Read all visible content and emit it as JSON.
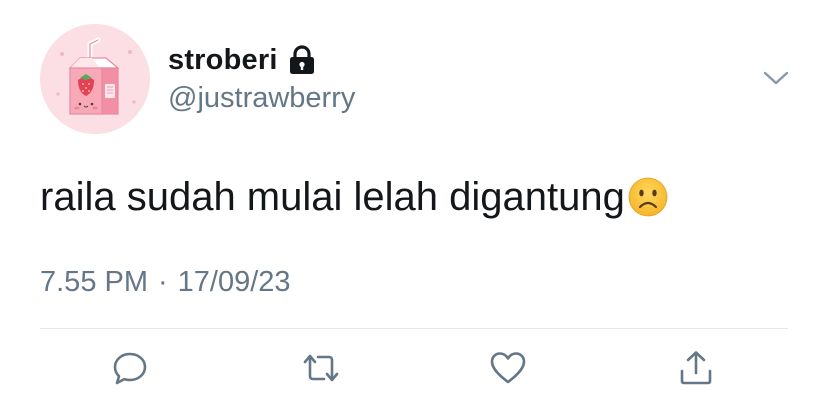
{
  "tweet": {
    "display_name": "stroberi",
    "handle": "@justrawberry",
    "protected_icon": "lock-icon",
    "text": "raila sudah mulai lelah digantung",
    "emoji": "frowning-face",
    "time": "7.55 PM",
    "separator": "·",
    "date": "17/09/23"
  },
  "actions": [
    {
      "name": "reply",
      "icon": "speech-bubble-icon"
    },
    {
      "name": "retweet",
      "icon": "retweet-icon"
    },
    {
      "name": "like",
      "icon": "heart-icon"
    },
    {
      "name": "share",
      "icon": "share-icon"
    }
  ],
  "colors": {
    "text": "#14171a",
    "secondary": "#657786",
    "divider": "#e1e8ed",
    "avatar_bg": "#fbdfe4",
    "action_icon": "#657786"
  }
}
